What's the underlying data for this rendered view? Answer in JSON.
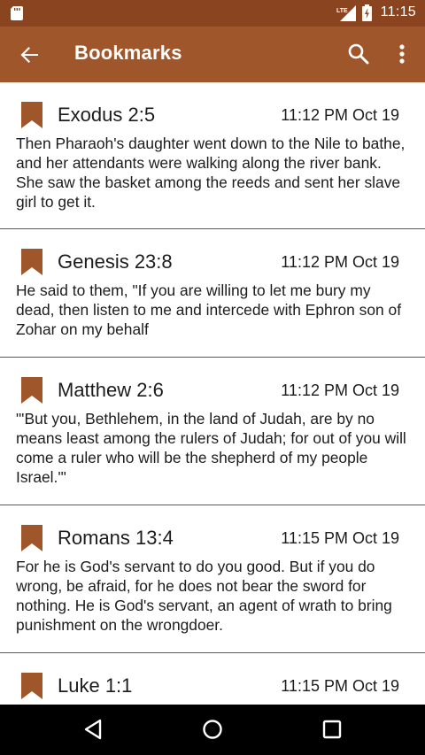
{
  "status_bar": {
    "network": "LTE",
    "time": "11:15"
  },
  "app_bar": {
    "title": "Bookmarks",
    "icons": [
      "back-arrow-icon",
      "search-icon",
      "more-vert-icon"
    ]
  },
  "bookmarks": [
    {
      "reference": "Exodus 2:5",
      "timestamp": "11:12 PM Oct 19",
      "text": " Then Pharaoh's daughter went down to the Nile to bathe, and her attendants were walking along the river bank. She saw the basket among the reeds and sent her slave girl to get it."
    },
    {
      "reference": "Genesis 23:8",
      "timestamp": "11:12 PM Oct 19",
      "text": " He said to them, \"If you are willing to let me bury my dead, then listen to me and intercede with Ephron son of Zohar on my behalf"
    },
    {
      "reference": "Matthew 2:6",
      "timestamp": "11:12 PM Oct 19",
      "text": " \"'But you, Bethlehem, in the land of Judah, are by no means least among the rulers of Judah; for out of you will come a ruler who will be the shepherd of my people Israel.'\""
    },
    {
      "reference": "Romans 13:4",
      "timestamp": "11:15 PM Oct 19",
      "text": " For he is God's servant to do you good. But if you do wrong, be afraid, for he does not bear the sword for nothing. He is God's servant, an agent of wrath to bring punishment on the wrongdoer."
    },
    {
      "reference": "Luke 1:1",
      "timestamp": "11:15 PM Oct 19",
      "text": ""
    }
  ],
  "colors": {
    "app_bar": "#a0562b",
    "status_bar": "#8a4520",
    "bookmark_icon": "#a0562b"
  }
}
